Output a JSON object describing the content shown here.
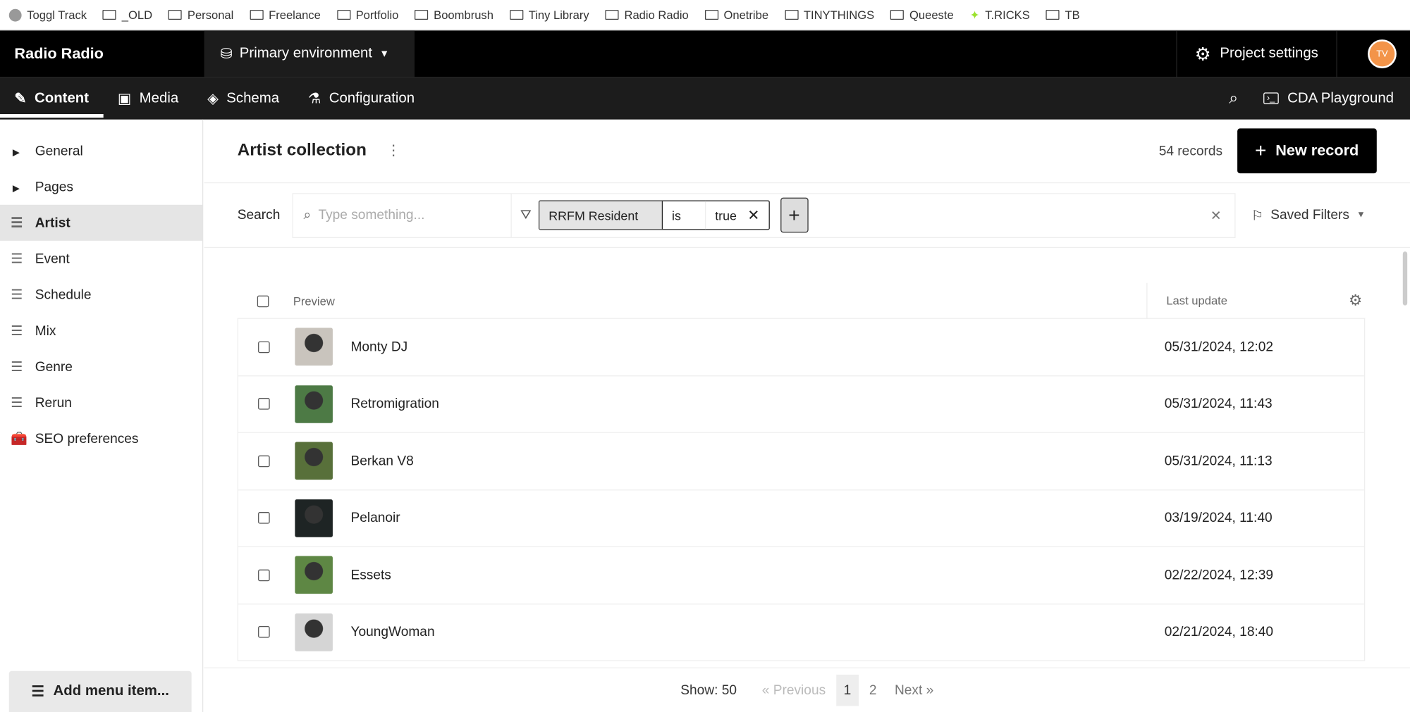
{
  "bookmarks": [
    "Toggl Track",
    "_OLD",
    "Personal",
    "Freelance",
    "Portfolio",
    "Boombrush",
    "Tiny Library",
    "Radio Radio",
    "Onetribe",
    "TINYTHINGS",
    "Queeste",
    "T.RICKS",
    "TB"
  ],
  "header": {
    "project": "Radio Radio",
    "environment": "Primary environment",
    "project_settings": "Project settings",
    "avatar": "TV"
  },
  "nav": {
    "tabs": [
      "Content",
      "Media",
      "Schema",
      "Configuration"
    ],
    "cda": "CDA Playground"
  },
  "sidebar": {
    "items": [
      {
        "label": "General",
        "icon": "caret-right-icon"
      },
      {
        "label": "Pages",
        "icon": "caret-right-icon"
      },
      {
        "label": "Artist",
        "icon": "list-icon"
      },
      {
        "label": "Event",
        "icon": "list-icon"
      },
      {
        "label": "Schedule",
        "icon": "list-icon"
      },
      {
        "label": "Mix",
        "icon": "list-icon"
      },
      {
        "label": "Genre",
        "icon": "list-icon"
      },
      {
        "label": "Rerun",
        "icon": "list-icon"
      },
      {
        "label": "SEO preferences",
        "icon": "toolbox-icon"
      }
    ],
    "add": "Add menu item..."
  },
  "main": {
    "title": "Artist collection",
    "count": "54 records",
    "new": "New record",
    "search": {
      "label": "Search",
      "placeholder": "Type something...",
      "filter": {
        "field": "RRFM Resident",
        "op": "is",
        "value": "true"
      },
      "saved": "Saved Filters"
    },
    "columns": {
      "preview": "Preview",
      "updated": "Last update"
    },
    "rows": [
      {
        "name": "Monty DJ",
        "date": "05/31/2024, 12:02",
        "color": "#c9c4bd"
      },
      {
        "name": "Retromigration",
        "date": "05/31/2024, 11:43",
        "color": "#4d7a45"
      },
      {
        "name": "Berkan V8",
        "date": "05/31/2024, 11:13",
        "color": "#58703a"
      },
      {
        "name": "Pelanoir",
        "date": "03/19/2024, 11:40",
        "color": "#1e2424"
      },
      {
        "name": "Essets",
        "date": "02/22/2024, 12:39",
        "color": "#5e8744"
      },
      {
        "name": "YoungWoman",
        "date": "02/21/2024, 18:40",
        "color": "#d5d5d5"
      }
    ],
    "pager": {
      "show": "Show: 50",
      "prev": "« Previous",
      "pages": [
        "1",
        "2"
      ],
      "next": "Next »"
    }
  }
}
